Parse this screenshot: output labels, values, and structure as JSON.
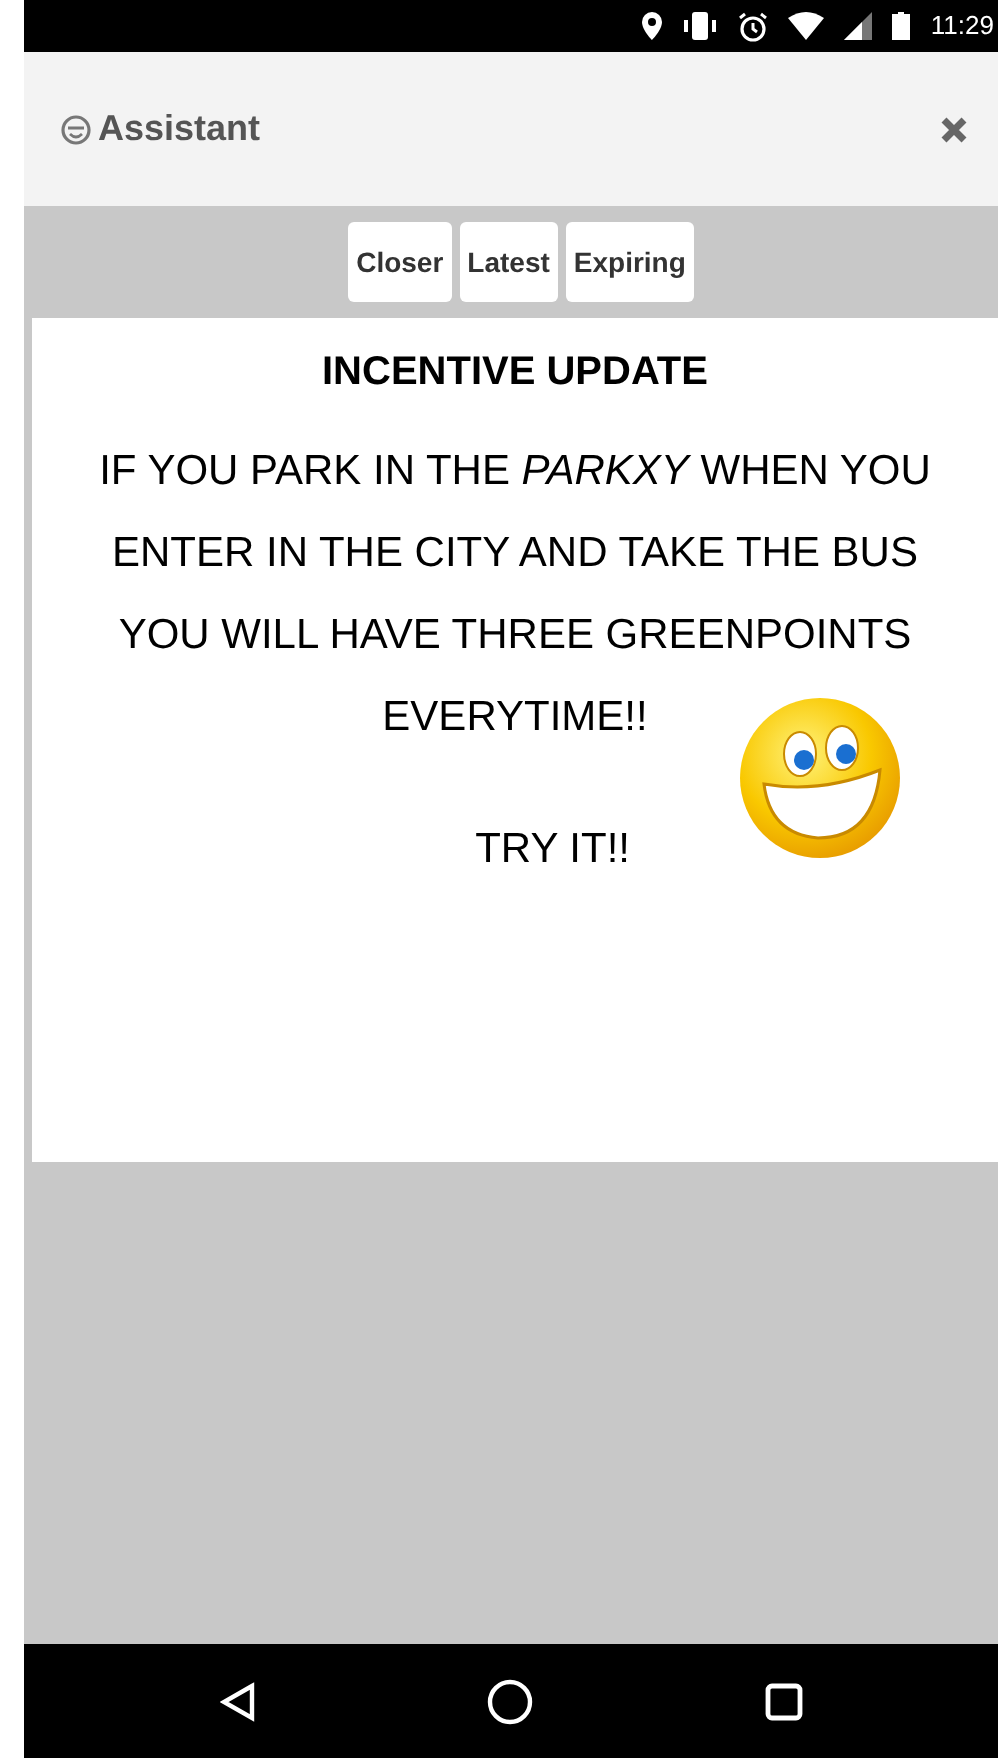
{
  "status_bar": {
    "time": "11:29"
  },
  "header": {
    "title": "Assistant"
  },
  "filters": [
    {
      "label": "Closer"
    },
    {
      "label": "Latest"
    },
    {
      "label": "Expiring"
    }
  ],
  "message": {
    "title": "INCENTIVE UPDATE",
    "body": "IF YOU PARK IN THE *PARKXY* WHEN YOU ENTER IN THE CITY AND TAKE THE BUS YOU WILL HAVE THREE GREENPOINTS EVERYTIME!!",
    "footer": "TRY IT!!"
  }
}
